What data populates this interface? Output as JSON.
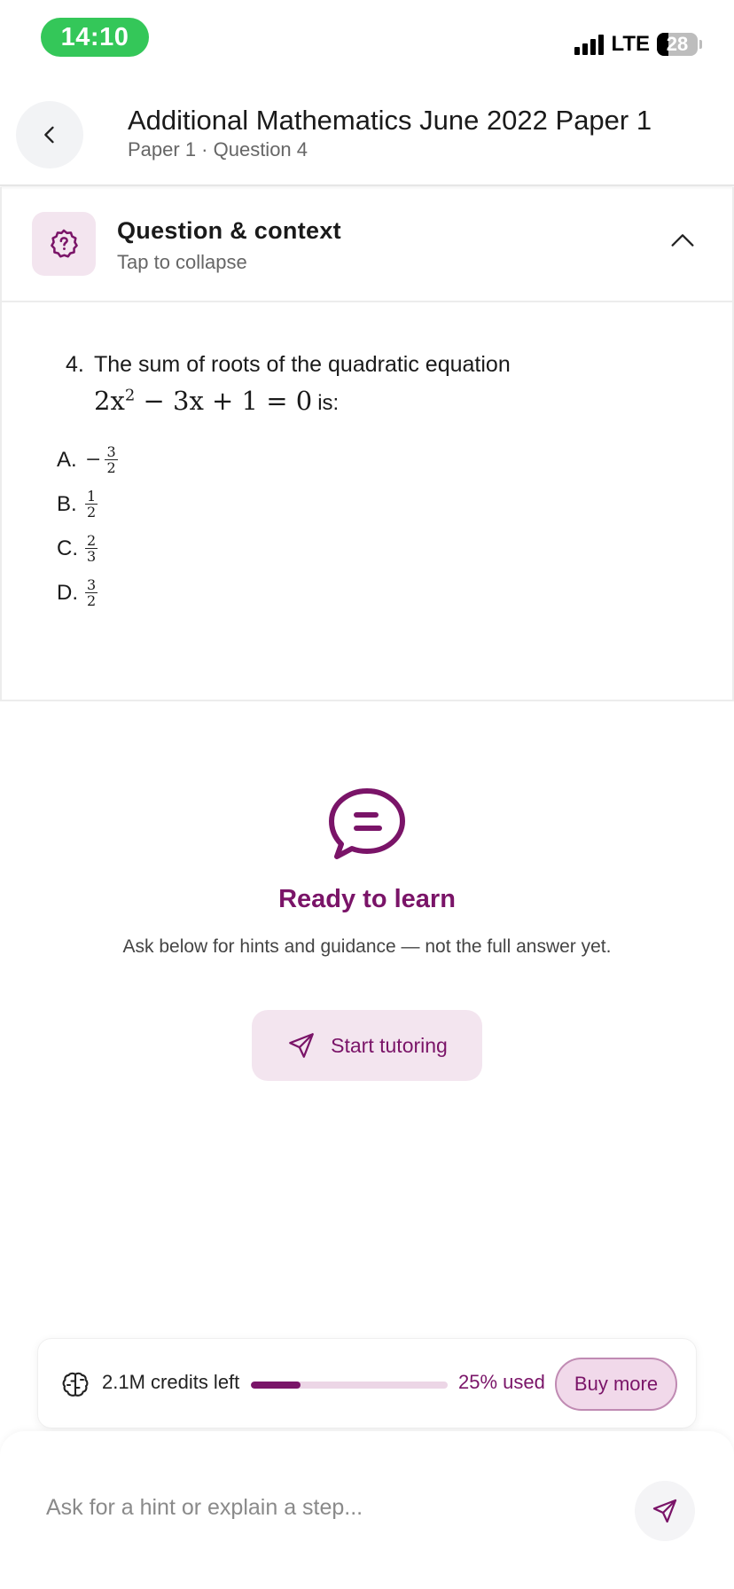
{
  "status_bar": {
    "time": "14:10",
    "network": "LTE",
    "battery": "28"
  },
  "header": {
    "title": "Additional Mathematics June 2022 Paper 1",
    "subtitle": "Paper 1 · Question 4",
    "back_icon": "chevron-left-icon"
  },
  "question_panel": {
    "title": "Question & context",
    "subtitle": "Tap to collapse",
    "icon": "question-badge-icon",
    "collapse_icon": "chevron-up-icon",
    "question": {
      "number": "4.",
      "text": "The sum of roots of the quadratic equation",
      "equation_lhs": "2x",
      "equation_exp": "2",
      "equation_rest": " − 3x + 1 = 0",
      "equation_suffix": "is:",
      "options": [
        {
          "label": "A.",
          "sign": "−",
          "numerator": "3",
          "denominator": "2"
        },
        {
          "label": "B.",
          "sign": "",
          "numerator": "1",
          "denominator": "2"
        },
        {
          "label": "C.",
          "sign": "",
          "numerator": "2",
          "denominator": "3"
        },
        {
          "label": "D.",
          "sign": "",
          "numerator": "3",
          "denominator": "2"
        }
      ]
    }
  },
  "empty_state": {
    "icon": "chat-bubble-icon",
    "title": "Ready to learn",
    "subtitle": "Ask below for hints and guidance — not the full answer yet.",
    "start_button": "Start tutoring",
    "start_icon": "send-icon"
  },
  "credits": {
    "icon": "brain-icon",
    "text": "2.1M credits left",
    "used_fraction": 0.25,
    "used_text": "25% used",
    "buy_button": "Buy more"
  },
  "input": {
    "placeholder": "Ask for a hint or explain a step...",
    "value": "",
    "send_icon": "send-icon"
  },
  "colors": {
    "accent": "#7a1468",
    "accent_soft": "#f3e5ef",
    "time_pill": "#34c759"
  }
}
